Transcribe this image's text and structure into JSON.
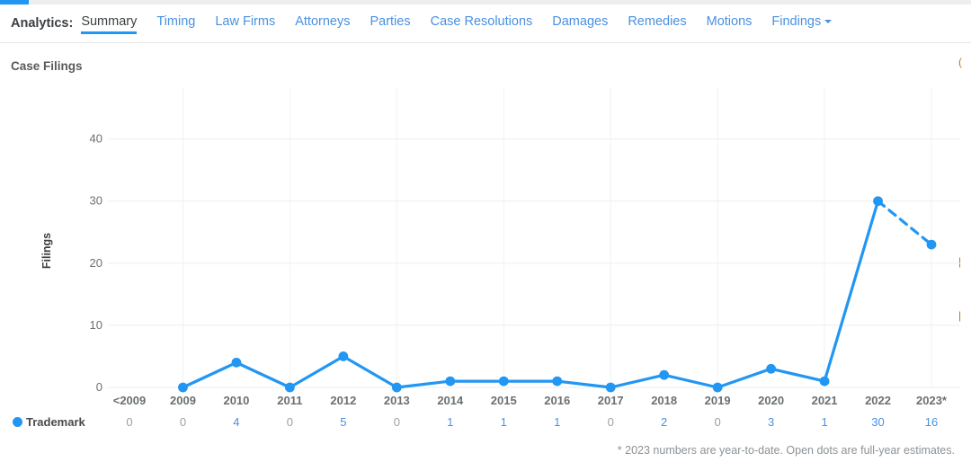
{
  "top_bar": {
    "progress_percent": 3
  },
  "nav": {
    "prefix": "Analytics:",
    "items": [
      {
        "label": "Summary",
        "active": true,
        "caret": false
      },
      {
        "label": "Timing",
        "active": false,
        "caret": false
      },
      {
        "label": "Law Firms",
        "active": false,
        "caret": false
      },
      {
        "label": "Attorneys",
        "active": false,
        "caret": false
      },
      {
        "label": "Parties",
        "active": false,
        "caret": false
      },
      {
        "label": "Case Resolutions",
        "active": false,
        "caret": false
      },
      {
        "label": "Damages",
        "active": false,
        "caret": false
      },
      {
        "label": "Remedies",
        "active": false,
        "caret": false
      },
      {
        "label": "Motions",
        "active": false,
        "caret": false
      },
      {
        "label": "Findings",
        "active": false,
        "caret": true
      }
    ]
  },
  "panel": {
    "title": "Case Filings",
    "footnote": "* 2023 numbers are year-to-date. Open dots are full-year estimates."
  },
  "legend": {
    "series_label": "Trademark",
    "series_color": "#2196f3"
  },
  "chart_data": {
    "type": "line",
    "title": "Case Filings",
    "xlabel": "",
    "ylabel": "Filings",
    "categories": [
      "<2009",
      "2009",
      "2010",
      "2011",
      "2012",
      "2013",
      "2014",
      "2015",
      "2016",
      "2017",
      "2018",
      "2019",
      "2020",
      "2021",
      "2022",
      "2023*"
    ],
    "series": [
      {
        "name": "Trademark",
        "color": "#2196f3",
        "values": [
          0,
          0,
          4,
          0,
          5,
          0,
          1,
          1,
          1,
          0,
          2,
          0,
          3,
          1,
          30,
          16
        ],
        "plotted_values": [
          null,
          0,
          4,
          0,
          5,
          0,
          1,
          1,
          1,
          0,
          2,
          0,
          3,
          1,
          30,
          23
        ],
        "dashed_from_index": 14
      }
    ],
    "ylim": [
      0,
      44
    ],
    "yticks": [
      0,
      10,
      20,
      30,
      40
    ],
    "grid": true,
    "legend_position": "bottom-left",
    "notes": "Final segment (2022 to 2023*) drawn dashed; 2023* marker plotted at the full-year estimate of 23 while the tabulated year-to-date count is 16."
  },
  "right_sliver": {
    "marks": [
      "(",
      "|",
      "|"
    ]
  }
}
